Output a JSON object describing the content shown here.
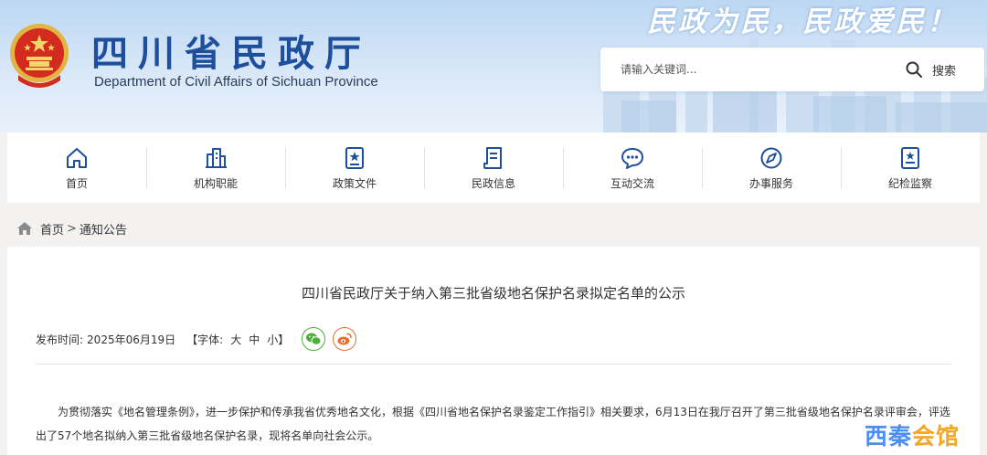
{
  "header": {
    "title": "四川省民政厅",
    "subtitle": "Department of Civil Affairs of Sichuan Province",
    "slogan": "民政为民，民政爱民！",
    "search": {
      "placeholder": "请输入关键词...",
      "button_label": "搜索"
    }
  },
  "nav": {
    "items": [
      {
        "label": "首页",
        "icon": "home-icon"
      },
      {
        "label": "机构职能",
        "icon": "building-icon"
      },
      {
        "label": "政策文件",
        "icon": "policy-document-icon"
      },
      {
        "label": "民政信息",
        "icon": "news-icon"
      },
      {
        "label": "互动交流",
        "icon": "chat-icon"
      },
      {
        "label": "办事服务",
        "icon": "compass-icon"
      },
      {
        "label": "纪检监察",
        "icon": "badge-icon"
      }
    ]
  },
  "breadcrumb": {
    "home": "首页",
    "separator": ">",
    "current": "通知公告"
  },
  "article": {
    "title": "四川省民政厅关于纳入第三批省级地名保护名录拟定名单的公示",
    "meta": {
      "date_label": "发布时间:",
      "date": "2025年06月19日",
      "font_label": "【字体:",
      "font_large": "大",
      "font_medium": "中",
      "font_small": "小",
      "font_close": "】"
    },
    "share": [
      "wechat-icon",
      "weibo-icon"
    ],
    "paragraph": "为贯彻落实《地名管理条例》，进一步保护和传承我省优秀地名文化，根据《四川省地名保护名录鉴定工作指引》相关要求，6月13日在我厅召开了第三批省级地名保护名录评审会，评选出了57个地名拟纳入第三批省级地名保护名录，现将名单向社会公示。"
  },
  "watermark": {
    "part1": "西秦",
    "part2": "会馆"
  },
  "colors": {
    "brand_blue": "#1e4f9c",
    "emblem_red": "#d42b1e",
    "wechat_green": "#4caf3b",
    "weibo_orange": "#e8702f"
  }
}
